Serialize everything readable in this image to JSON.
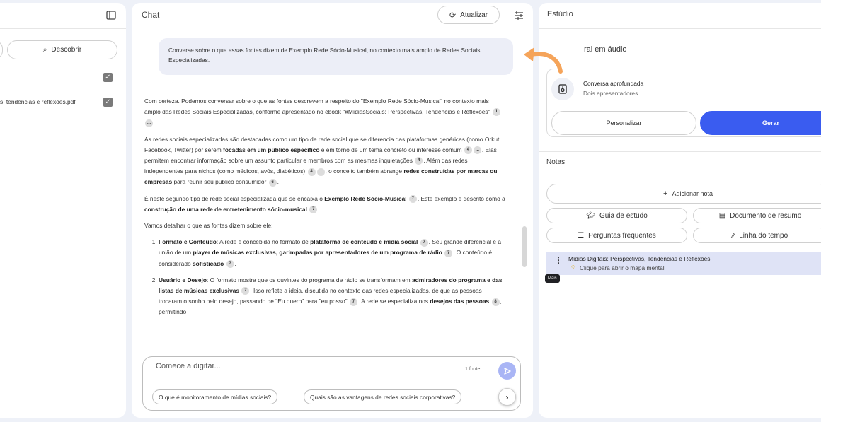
{
  "sources": {
    "discover_label": "Descobrir",
    "item_label": "s, tendências e reflexões.pdf"
  },
  "chat": {
    "title": "Chat",
    "refresh_label": "Atualizar",
    "user_message": "Converse sobre o que essas fontes dizem de Exemplo Rede Sócio-Musical, no contexto mais amplo de Redes Sociais Especializadas.",
    "answer": {
      "p1": [
        "Com certeza. Podemos conversar sobre o que as fontes descrevem a respeito do \"Exemplo Rede Sócio-Musical\" no contexto mais amplo das Redes Sociais Especializadas, conforme apresentado no ebook \"#MídiasSociais: Perspectivas, Tendências e Reflexões\""
      ],
      "p2a": "As redes sociais especializadas são destacadas como um tipo de rede social que se diferencia das plataformas genéricas (como Orkut, Facebook, Twitter) por serem ",
      "p2b": "focadas em um público específico",
      "p2c": " e em torno de um tema concreto ou interesse comum",
      "p2d": ". Elas permitem encontrar informação sobre um assunto particular e membros com as mesmas inquietações",
      "p2e": ". Além das redes independentes para nichos (como médicos, avós, diabéticos)",
      "p2f": ", o conceito também abrange ",
      "p2g": "redes construídas por marcas ou empresas",
      "p2h": " para reunir seu público consumidor",
      "p3a": "É neste segundo tipo de rede social especializada que se encaixa o ",
      "p3b": "Exemplo Rede Sócio-Musical",
      "p3c": ". Este exemplo é descrito como a ",
      "p3d": "construção de uma rede de entretenimento sócio-musical",
      "p4": "Vamos detalhar o que as fontes dizem sobre ele:",
      "li1a": "Formato e Conteúdo",
      "li1b": ": A rede é concebida no formato de ",
      "li1c": "plataforma de conteúdo e mídia social",
      "li1d": ". Seu grande diferencial é a união de um ",
      "li1e": "player de músicas exclusivas, garimpadas por apresentadores de um programa de rádio",
      "li1f": ". O conteúdo é considerado ",
      "li1g": "sofisticado",
      "li2a": "Usuário e Desejo",
      "li2b": ": O formato mostra que os ouvintes do programa de rádio se transformam em ",
      "li2c": "admiradores do programa e das listas de músicas exclusivas",
      "li2d": ". Isso reflete a ideia, discutida no contexto das redes especializadas, de que as pessoas trocaram o sonho pelo desejo, passando de \"Eu quero\" para \"eu posso\"",
      "li2e": ". A rede se especializa nos ",
      "li2f": "desejos das pessoas",
      "li2g": ", permitindo"
    },
    "citations": {
      "c1": "1",
      "more": "...",
      "c4": "4",
      "c6": "6",
      "c7": "7",
      "c8": "8"
    },
    "input_placeholder": "Comece a digitar...",
    "source_count": "1 fonte",
    "suggestions": [
      "O que é monitoramento de mídias sociais?",
      "Quais são as vantagens de redes sociais corporativas?"
    ]
  },
  "studio": {
    "title": "Estúdio",
    "audio_heading": "ral em áudio",
    "audio_card_title": "Conversa aprofundada",
    "audio_card_sub": "Dois apresentadores",
    "customize_label": "Personalizar",
    "generate_label": "Gerar",
    "notes_heading": "Notas",
    "add_note_label": "Adicionar nota",
    "study_guide_label": "Guia de estudo",
    "summary_doc_label": "Documento de resumo",
    "faq_label": "Perguntas frequentes",
    "timeline_label": "Linha do tempo",
    "note_title": "Mídias Digitais: Perspectivas, Tendências e Reflexões",
    "note_sub": "Clique para abrir o mapa mental",
    "tooltip": "Mais"
  },
  "colors": {
    "accent": "#3a5cf0",
    "arrow": "#f5a45a",
    "note_bg": "#dfe3f6"
  }
}
